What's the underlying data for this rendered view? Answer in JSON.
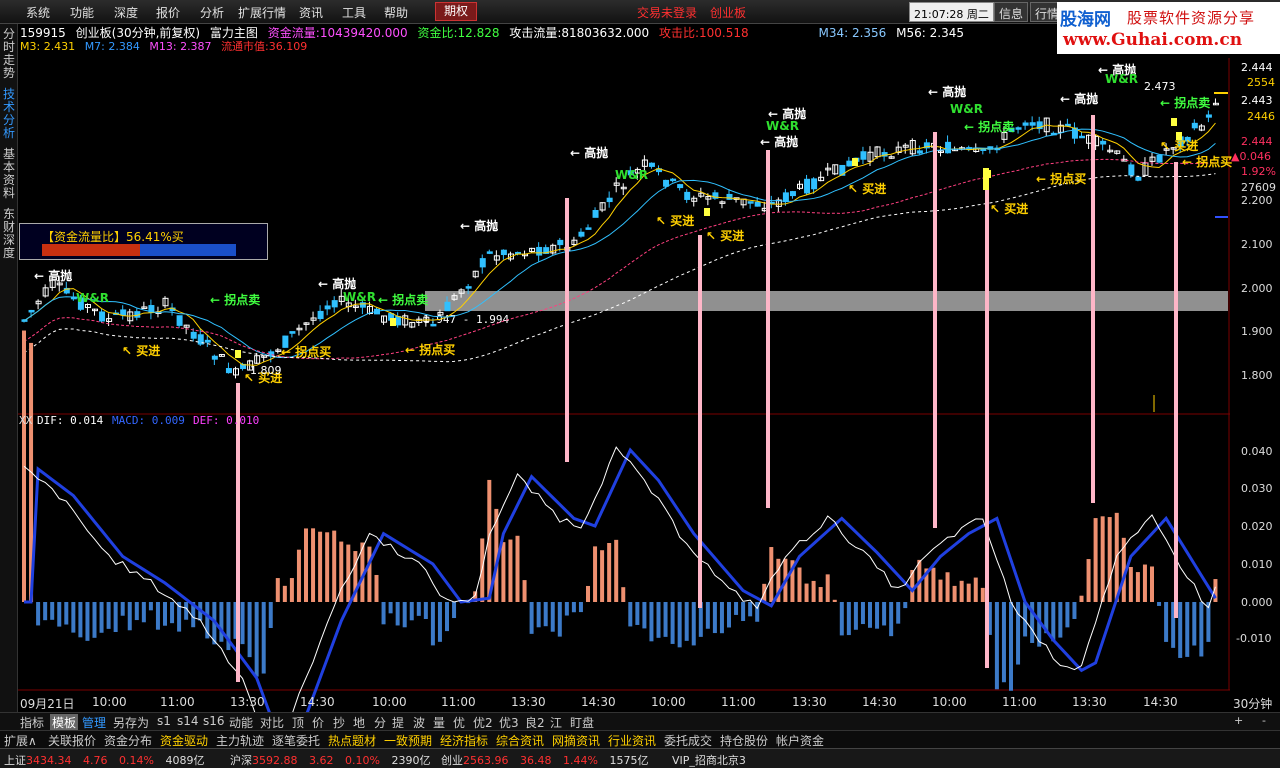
{
  "menu": [
    "系统",
    "功能",
    "深度",
    "报价",
    "分析",
    "扩展行情",
    "资讯",
    "工具",
    "帮助"
  ],
  "active_menu": "期权",
  "red_links": [
    "交易未登录",
    "创业板"
  ],
  "clock": "21:07:28",
  "weekday": "周二",
  "right_buttons": [
    "信息",
    "行情"
  ],
  "logo": {
    "site": "股海网",
    "slogan": "股票软件资源分享",
    "url": "www.Guhai.com.cn"
  },
  "left_tabs": [
    "分时走势",
    "技术分析",
    "基本资料",
    "东财深度"
  ],
  "header": {
    "code": "159915",
    "name": "创业板(30分钟,前复权)",
    "indicator": "富力主图",
    "fund_flow_label": "资金流量:",
    "fund_flow": "10439420.000",
    "fund_ratio_label": "资金比:",
    "fund_ratio": "12.828",
    "attack_flow_label": "攻击流量:",
    "attack_flow": "81803632.000",
    "attack_ratio_label": "攻击比:",
    "attack_ratio": "100.518",
    "ma34": "M34: 2.356",
    "ma56": "M56: 2.345",
    "ma3": "M3: 2.431",
    "ma7": "M7: 2.384",
    "ma13": "M13: 2.387",
    "cap_label": "流通市值:",
    "cap": "36.109"
  },
  "flowbox": {
    "label": "【资金流量比】56.41%买",
    "buy_ratio": 0.5641
  },
  "price_axis": [
    "2.444",
    "2.443",
    "2.444",
    "2.200",
    "2.100",
    "2.000",
    "1.900",
    "1.800"
  ],
  "right_overlays": [
    "2554",
    "2446",
    "▲0.046",
    "1.92%",
    "27609"
  ],
  "range_label": "1.947 - 1.994",
  "high_label": "2.473",
  "low_label": "1.809",
  "annotations": {
    "high": "高抛",
    "buy": "买进",
    "turn_sell": "拐点卖",
    "turn_buy": "拐点买",
    "wr": "W&R"
  },
  "macd_header": {
    "prefix": "XX",
    "dif": "DIF: 0.014",
    "macd": "MACD: 0.009",
    "dea": "DEF: 0.010"
  },
  "macd_axis": [
    "0.040",
    "0.030",
    "0.020",
    "0.010",
    "0.000",
    "-0.010"
  ],
  "time_axis": [
    "09月21日",
    "10:00",
    "11:00",
    "13:30",
    "14:30",
    "10:00",
    "11:00",
    "13:30",
    "14:30",
    "10:00",
    "11:00",
    "13:30",
    "14:30",
    "10:00",
    "11:00",
    "13:30",
    "14:30"
  ],
  "period": "30分钟",
  "bottom_tabs": [
    "指标",
    "模板",
    "管理",
    "另存为",
    "s1",
    "s14",
    "s16",
    "动能",
    "对比",
    "顶",
    "价",
    "抄",
    "地",
    "分",
    "提",
    "波",
    "量",
    "优",
    "优2",
    "优3",
    "良2",
    "江",
    "盯盘"
  ],
  "func_tabs": [
    "扩展∧",
    "关联报价",
    "资金分布",
    "资金驱动",
    "主力轨迹",
    "逐笔委托",
    "热点题材",
    "一致预期",
    "经济指标",
    "综合资讯",
    "网摘资讯",
    "行业资讯",
    "委托成交",
    "持仓股份",
    "帐户资金"
  ],
  "status": [
    {
      "name": "上证",
      "value": "3434.34",
      "change": "4.76",
      "pct": "0.14%",
      "vol": "4089亿"
    },
    {
      "name": "沪深",
      "value": "3592.88",
      "change": "3.62",
      "pct": "0.10%",
      "vol": "2390亿"
    },
    {
      "name": "创业",
      "value": "2563.96",
      "change": "36.48",
      "pct": "1.44%",
      "vol": "1575亿"
    }
  ],
  "server": "VIP_招商北京3",
  "colors": {
    "up": "#ff3030",
    "macd_up": "#ee9070",
    "macd_down": "#3c7ac8",
    "dif": "#ffffff",
    "dea": "#2040e0",
    "highlight": "#ffd000",
    "signal": "#ffb6c8"
  }
}
